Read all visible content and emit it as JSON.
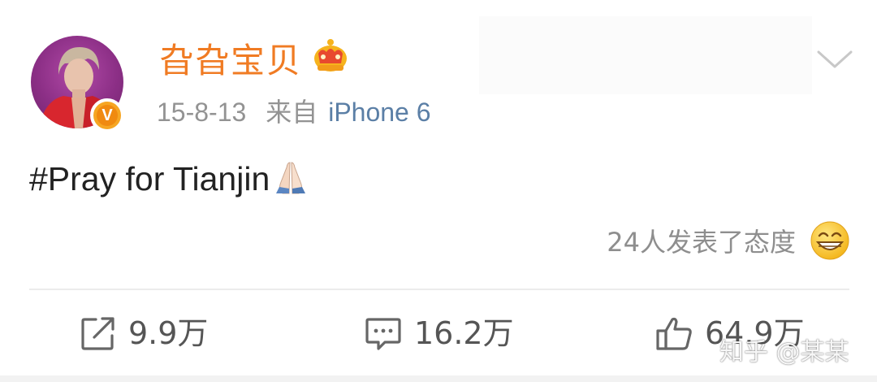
{
  "post": {
    "author": {
      "name": "旮旮宝贝",
      "verified": true,
      "badge_icon": "crown-icon",
      "verified_mark": "V"
    },
    "meta": {
      "date": "15-8-13",
      "from_label": "来自",
      "device": "iPhone 6"
    },
    "text": "#Pray for Tianjin",
    "text_emoji": "pray-icon",
    "reactions": {
      "label": "24人发表了态度",
      "icon": "grin-icon"
    }
  },
  "actions": {
    "repost": {
      "icon": "repost-icon",
      "count": "9.9万"
    },
    "comment": {
      "icon": "comment-icon",
      "count": "16.2万"
    },
    "like": {
      "icon": "thumbs-up-icon",
      "count": "64.9万"
    }
  },
  "watermark": "知乎 @某某",
  "colors": {
    "username": "#f07b23",
    "device_link": "#5b7fa6",
    "meta_text": "#939393",
    "body_text": "#222222",
    "badge": "#f6a623"
  }
}
